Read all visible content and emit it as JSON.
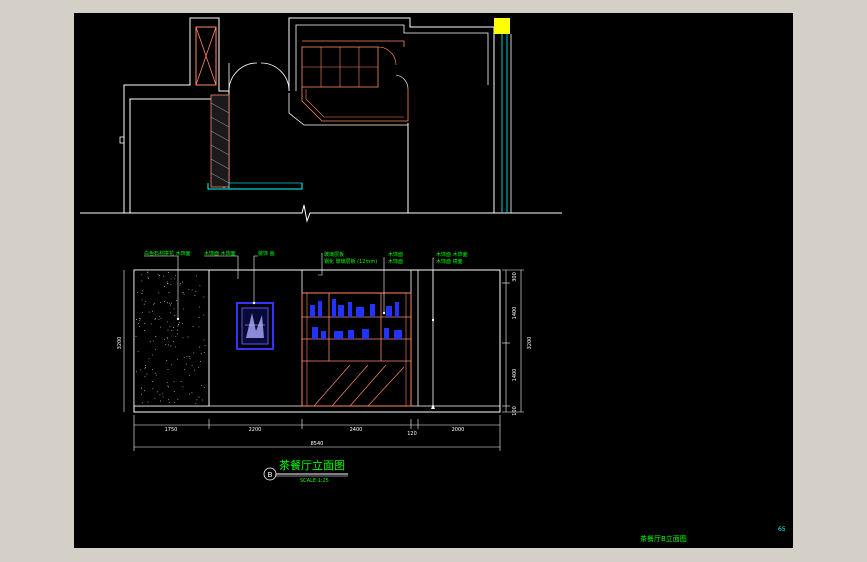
{
  "drawing": {
    "title": "茶餐厅立面图",
    "scale": "SCALE 1:25",
    "section_mark": "B",
    "sheet_footer": "茶餐厅B立面图",
    "page_number": "65"
  },
  "elevation": {
    "dimensions_horizontal": [
      "1750",
      "2200",
      "2400",
      "120",
      "2000"
    ],
    "dimension_total": "8540",
    "dimension_height_left": "3200",
    "dimensions_right": [
      "300",
      "1400",
      "1400",
      "100"
    ],
    "dimension_height_right": "3200"
  },
  "callouts": {
    "c1": "白色石材拼花 木饰面",
    "c2": "木饰面 木饰面",
    "c3": "装饰 画",
    "c4a": "玻璃层板",
    "c4b": "钢化 玻璃层板 (12mm)",
    "c5a": "木饰面",
    "c5b": "木饰面",
    "c6a": "木饰面 木饰面",
    "c6b": "木饰面 镜面"
  },
  "colors": {
    "sheet_background": "#000000",
    "window_background": "#d4d0c8",
    "wall_lines": "#ffffff",
    "wood_lines": "#ff8866",
    "glass_lines": "#00ffff",
    "annotation": "#00ff00",
    "decor_blue": "#3333ff",
    "column_marker": "#ffff00"
  }
}
